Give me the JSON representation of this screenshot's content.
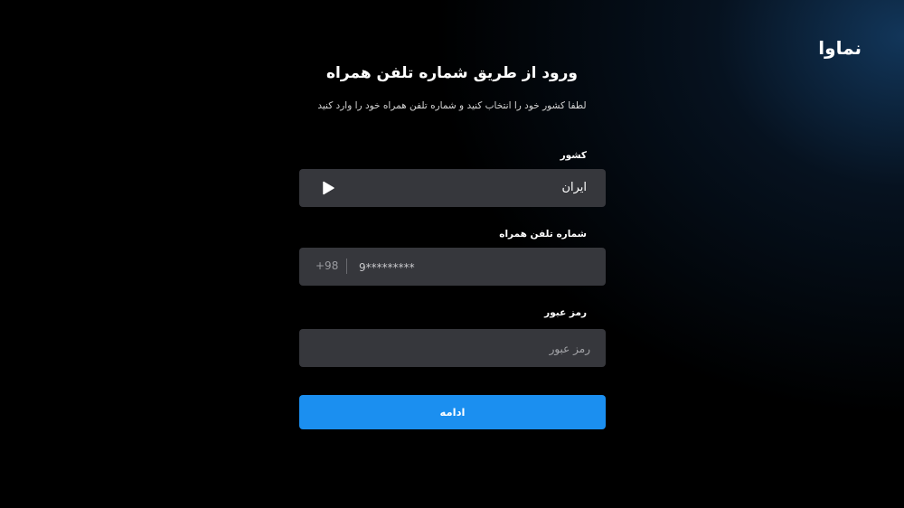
{
  "brand": {
    "logo_text": "نماوا"
  },
  "header": {
    "title": "ورود از طریق شماره تلفن همراه",
    "subtitle": "لطفا کشور خود را انتخاب کنید و شماره تلفن همراه خود را وارد کنید"
  },
  "form": {
    "country": {
      "label": "کشور",
      "value": "ایران",
      "icon": "play-icon"
    },
    "phone": {
      "label": "شماره تلفن همراه",
      "prefix": "+98",
      "value": "",
      "placeholder": "9*********"
    },
    "password": {
      "label": "رمز عبور",
      "value": "",
      "placeholder": "رمز عبور"
    },
    "submit_label": "ادامه"
  },
  "colors": {
    "background": "#000000",
    "field_background": "#36373c",
    "accent": "#1b8ff0"
  }
}
